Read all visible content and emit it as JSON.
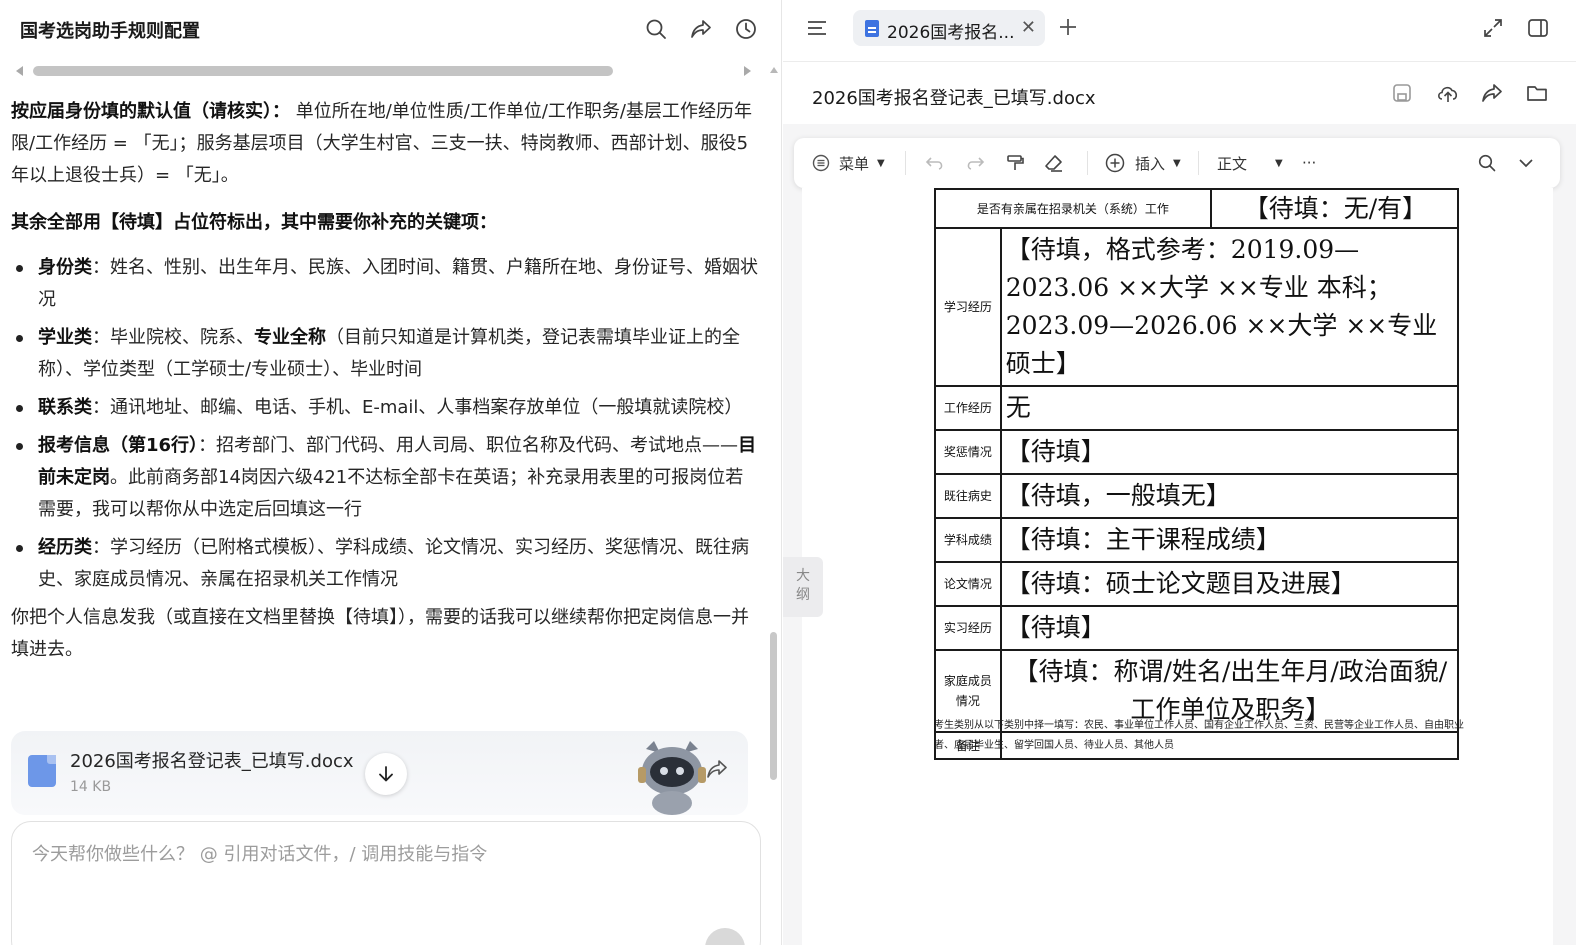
{
  "left": {
    "title": "国考选岗助手规则配置",
    "icons": [
      "search-icon",
      "share-icon",
      "history-icon"
    ],
    "intro": {
      "bold": "按应届身份填的默认值（请核实）：",
      "text": " 单位所在地/单位性质/工作单位/工作职务/基层工作经历年限/工作经历 = 「无」；服务基层项目（大学生村官、三支一扶、特岗教师、西部计划、服役5年以上退役士兵）= 「无」。"
    },
    "rest": "其余全部用【待填】占位符标出，其中需要你补充的关键项：",
    "bullets": [
      {
        "bold": "身份类",
        "text": "：姓名、性别、出生年月、民族、入团时间、籍贯、户籍所在地、身份证号、婚姻状况"
      },
      {
        "bold": "学业类",
        "text": "：毕业院校、院系、",
        "bold2": "专业全称",
        "text2": "（目前只知道是计算机类，登记表需填毕业证上的全称）、学位类型（工学硕士/专业硕士）、毕业时间"
      },
      {
        "bold": "联系类",
        "text": "：通讯地址、邮编、电话、手机、E-mail、人事档案存放单位（一般填就读院校）"
      },
      {
        "bold": "报考信息（第16行）",
        "text": "：招考部门、部门代码、用人司局、职位名称及代码、考试地点——",
        "bold2": "目前未定岗",
        "text2": "。此前商务部14岗因六级421不达标全部卡在英语；补充录用表里的可报岗位若需要，我可以帮你从中选定后回填这一行"
      },
      {
        "bold": "经历类",
        "text": "：学习经历（已附格式模板）、学科成绩、论文情况、实习经历、奖惩情况、既往病史、家庭成员情况、亲属在招录机关工作情况"
      }
    ],
    "closing": "你把个人信息发我（或直接在文档里替换【待填】），需要的话我可以继续帮你把定岗信息一并填进去。",
    "file": {
      "name": "2026国考报名登记表_已填写.docx",
      "size": "14 KB"
    },
    "input_placeholder": "今天帮你做些什么？ @ 引用对话文件，/ 调用技能与指令"
  },
  "right": {
    "tab_label": "2026国考报名...",
    "doc_title": "2026国考报名登记表_已填写.docx",
    "toolbar": {
      "menu": "菜单",
      "insert": "插入",
      "style": "正文",
      "more": "···"
    },
    "outline_label": "大纲",
    "table": {
      "relative_label": "是否有亲属在招录机关（系统）工作",
      "relative_value": "【待填：无/有】",
      "rows": [
        {
          "label": "学习经历",
          "value": "【待填，格式参考：2019.09—2023.06 ××大学 ××专业 本科；2023.09—2026.06 ××大学 ××专业 硕士】"
        },
        {
          "label": "工作经历",
          "value": "无"
        },
        {
          "label": "奖惩情况",
          "value": "【待填】"
        },
        {
          "label": "既往病史",
          "value": "【待填，一般填无】"
        },
        {
          "label": "学科成绩",
          "value": "【待填：主干课程成绩】"
        },
        {
          "label": "论文情况",
          "value": "【待填：硕士论文题目及进展】"
        },
        {
          "label": "实习经历",
          "value": "【待填】"
        },
        {
          "label": "家庭成员情况",
          "value": "【待填：称谓/姓名/出生年月/政治面貌/工作单位及职务】"
        },
        {
          "label": "备注",
          "value": ""
        }
      ]
    },
    "note": "考生类别从以下类别中择一填写：农民、事业单位工作人员、国有企业工作人员、三资、民营等企业工作人员、自由职业者、应届毕业生、留学回国人员、待业人员、其他人员"
  },
  "colors": {
    "accent": "#3e73e0",
    "border": "#1a1a1a",
    "panel_bg": "#f5f5f6"
  }
}
